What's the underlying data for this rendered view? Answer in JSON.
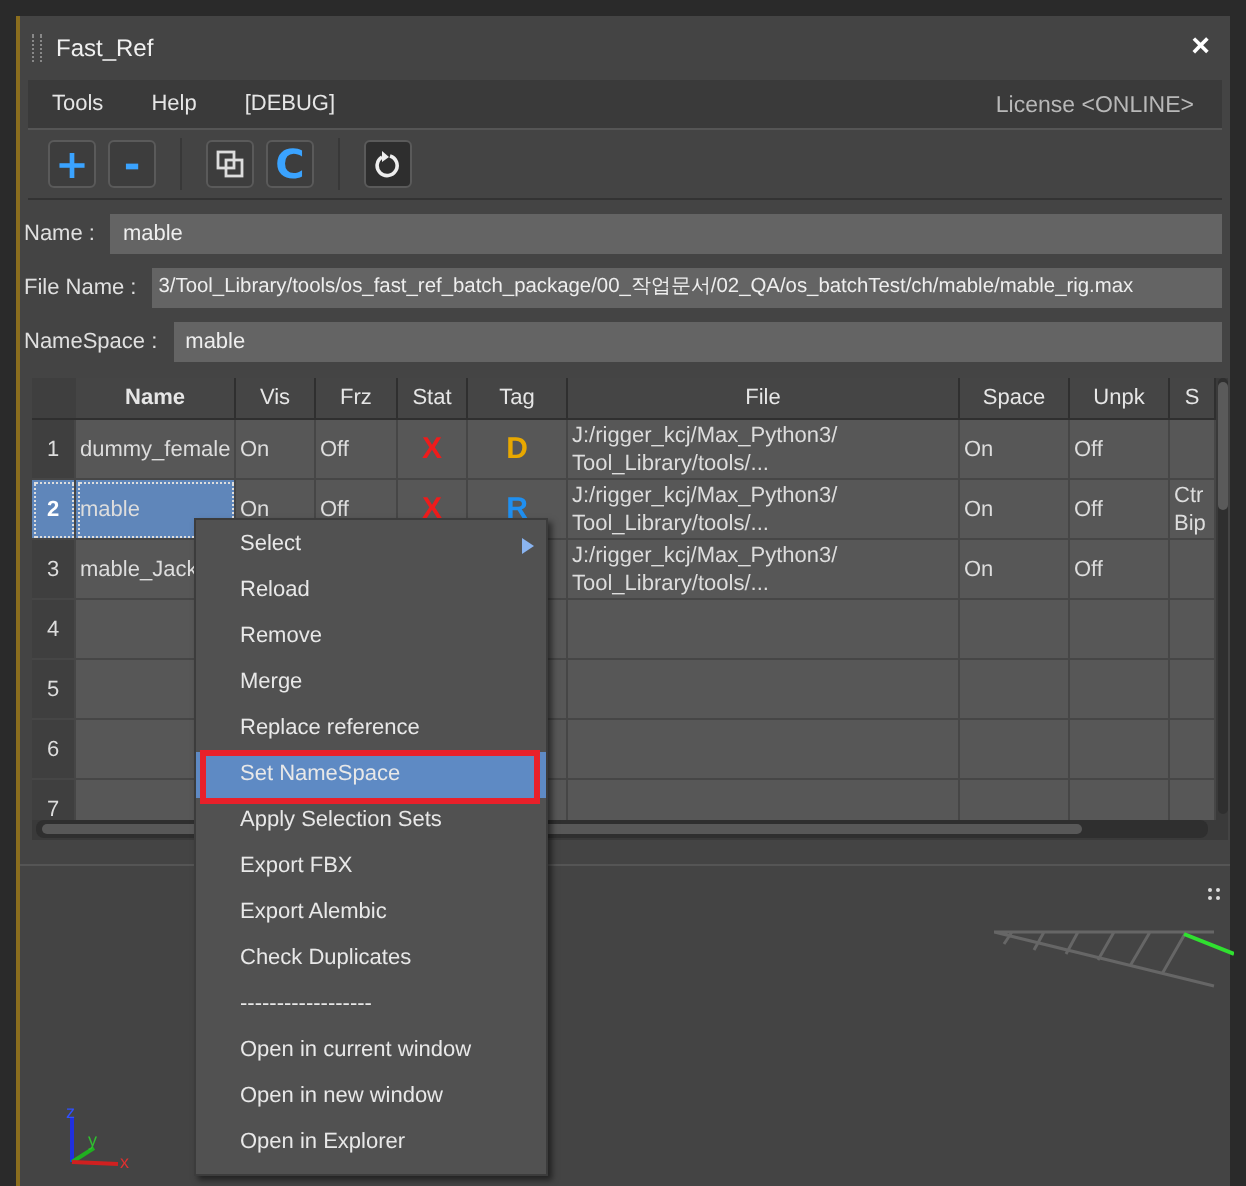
{
  "window": {
    "title": "Fast_Ref",
    "close": "×"
  },
  "menu_bar": {
    "items": [
      "Tools",
      "Help",
      "[DEBUG]"
    ],
    "license": "License <ONLINE>"
  },
  "toolbar": [
    {
      "kind": "text",
      "label": "+"
    },
    {
      "kind": "text",
      "label": "-"
    },
    {
      "kind": "separator"
    },
    {
      "kind": "copy"
    },
    {
      "kind": "text",
      "label": "C"
    },
    {
      "kind": "separator"
    },
    {
      "kind": "refresh"
    }
  ],
  "fields": [
    {
      "label": "Name :",
      "value": "mable"
    },
    {
      "label": "File Name :",
      "value": "3/Tool_Library/tools/os_fast_ref_batch_package/00_작업문서/02_QA/os_batchTest/ch/mable/mable_rig.max"
    },
    {
      "label": "NameSpace :",
      "value": "mable"
    }
  ],
  "table": {
    "columns": [
      "Name",
      "Vis",
      "Frz",
      "Stat",
      "Tag",
      "File",
      "Space",
      "Unpk",
      "S"
    ],
    "rows": [
      {
        "number": "1",
        "selected": false,
        "cells": [
          {
            "lines": [
              "dummy_female"
            ]
          },
          {
            "lines": [
              "On"
            ]
          },
          {
            "lines": [
              "Off"
            ]
          },
          {
            "lines": [
              "X"
            ],
            "color": "#ee1c1c"
          },
          {
            "lines": [
              "D"
            ],
            "color": "#e8a800"
          },
          {
            "lines": [
              "J:/rigger_kcj/Max_Python3/",
              "Tool_Library/tools/..."
            ]
          },
          {
            "lines": [
              "On"
            ]
          },
          {
            "lines": [
              "Off"
            ]
          },
          null
        ]
      },
      {
        "number": "2",
        "selected": true,
        "cells": [
          {
            "lines": [
              "mable"
            ]
          },
          {
            "lines": [
              "On"
            ]
          },
          {
            "lines": [
              "Off"
            ]
          },
          {
            "lines": [
              "X"
            ],
            "color": "#ee1c1c"
          },
          {
            "lines": [
              "R"
            ],
            "color": "#1f8ff0"
          },
          {
            "lines": [
              "J:/rigger_kcj/Max_Python3/",
              "Tool_Library/tools/..."
            ]
          },
          {
            "lines": [
              "On"
            ]
          },
          {
            "lines": [
              "Off"
            ]
          },
          {
            "lines": [
              "Ctr",
              "Bip"
            ]
          }
        ]
      },
      {
        "number": "3",
        "selected": false,
        "cells": [
          {
            "lines": [
              "mable_Jack"
            ]
          },
          null,
          null,
          null,
          null,
          {
            "lines": [
              "J:/rigger_kcj/Max_Python3/",
              "Tool_Library/tools/..."
            ]
          },
          {
            "lines": [
              "On"
            ]
          },
          {
            "lines": [
              "Off"
            ]
          },
          null
        ]
      },
      {
        "number": "4",
        "selected": false
      },
      {
        "number": "5",
        "selected": false
      },
      {
        "number": "6",
        "selected": false
      },
      {
        "number": "7",
        "selected": false
      }
    ]
  },
  "context_menu": {
    "items": [
      {
        "label": "Select",
        "submenu": true,
        "selected": false,
        "outlined": false
      },
      {
        "label": "Reload",
        "submenu": false,
        "selected": false,
        "outlined": false
      },
      {
        "label": "Remove",
        "submenu": false,
        "selected": false,
        "outlined": false
      },
      {
        "label": "Merge",
        "submenu": false,
        "selected": false,
        "outlined": false
      },
      {
        "label": "Replace reference",
        "submenu": false,
        "selected": false,
        "outlined": false
      },
      {
        "label": "Set NameSpace",
        "submenu": false,
        "selected": true,
        "outlined": true
      },
      {
        "label": "Apply Selection Sets",
        "submenu": false,
        "selected": false,
        "outlined": false
      },
      {
        "label": "Export FBX",
        "submenu": false,
        "selected": false,
        "outlined": false
      },
      {
        "label": "Export Alembic",
        "submenu": false,
        "selected": false,
        "outlined": false
      },
      {
        "label": "Check Duplicates",
        "submenu": false,
        "selected": false,
        "outlined": false
      },
      {
        "label": "------------------",
        "submenu": false,
        "selected": false,
        "outlined": false
      },
      {
        "label": "Open in current window",
        "submenu": false,
        "selected": false,
        "outlined": false
      },
      {
        "label": "Open in new window",
        "submenu": false,
        "selected": false,
        "outlined": false
      },
      {
        "label": "Open in Explorer",
        "submenu": false,
        "selected": false,
        "outlined": false
      }
    ]
  },
  "viewport": {
    "axis_labels": [
      "z",
      "y",
      "x"
    ]
  }
}
